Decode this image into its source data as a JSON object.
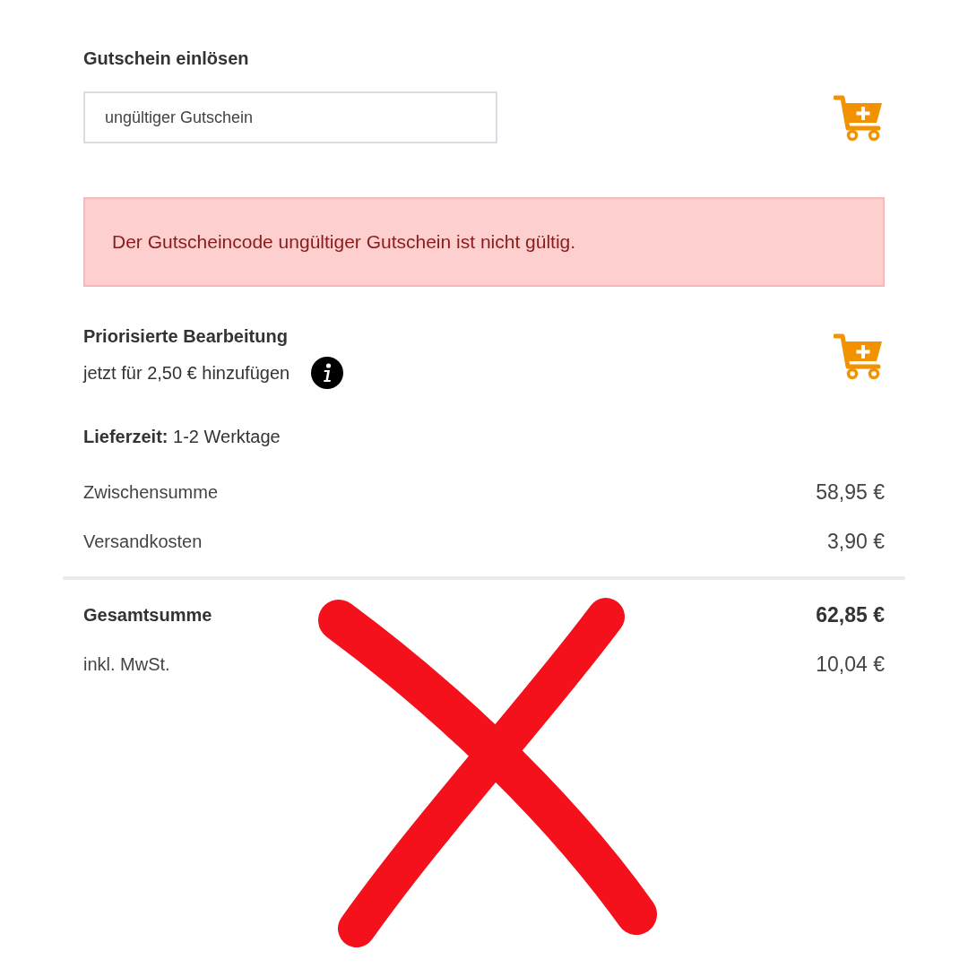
{
  "coupon": {
    "title": "Gutschein einlösen",
    "value": "ungültiger Gutschein"
  },
  "alert": {
    "message": "Der Gutscheincode ungültiger Gutschein ist nicht gültig."
  },
  "priority": {
    "title": "Priorisierte Bearbeitung",
    "subtitle": "jetzt für 2,50 € hinzufügen"
  },
  "delivery": {
    "label": "Lieferzeit:",
    "value": "1-2 Werktage"
  },
  "summary": [
    {
      "label": "Zwischensumme",
      "amount": "58,95 €"
    },
    {
      "label": "Versandkosten",
      "amount": "3,90 €"
    }
  ],
  "total": {
    "label": "Gesamtsumme",
    "amount": "62,85 €"
  },
  "tax": {
    "label": "inkl. MwSt.",
    "amount": "10,04 €"
  }
}
